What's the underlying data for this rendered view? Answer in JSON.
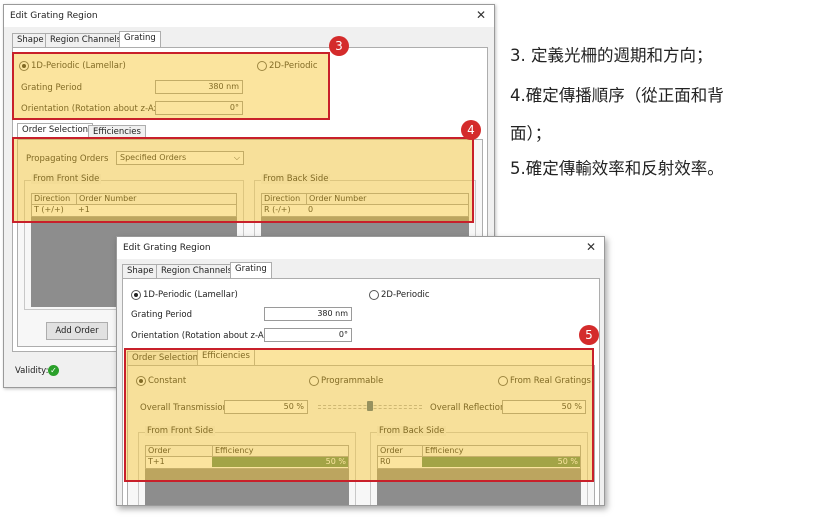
{
  "dialog_title": "Edit Grating Region",
  "tabs": [
    "Shape",
    "Region Channels",
    "Grating"
  ],
  "grating": {
    "periodic_1d": "1D-Periodic (Lamellar)",
    "periodic_2d": "2D-Periodic",
    "period_label": "Grating Period",
    "period_value": "380 nm",
    "orientation_label": "Orientation (Rotation about z-Axis)",
    "orientation_value": "0°"
  },
  "subtabs": [
    "Order Selection",
    "Efficiencies"
  ],
  "order_selection": {
    "propagating_label": "Propagating Orders",
    "propagating_value": "Specified Orders",
    "front_title": "From Front Side",
    "back_title": "From Back Side",
    "col_direction": "Direction",
    "col_order_number": "Order Number",
    "front_direction": "T (+/+)",
    "front_order": "+1",
    "back_direction": "R (-/+)",
    "back_order": "0",
    "add_order": "Add Order"
  },
  "validity_label": "Validity:",
  "efficiencies": {
    "constant": "Constant",
    "programmable": "Programmable",
    "from_real": "From Real Gratings",
    "transmission_label": "Overall Transmission",
    "transmission_value": "50 %",
    "reflection_label": "Overall Reflection",
    "reflection_value": "50 %",
    "slider_fraction": 0.5,
    "front_title": "From Front Side",
    "back_title": "From Back Side",
    "col_order": "Order",
    "col_efficiency": "Efficiency",
    "front_order": "T+1",
    "front_eff": "50 %",
    "back_order": "R0",
    "back_eff": "50 %"
  },
  "badges": [
    "3",
    "4",
    "5"
  ],
  "notes": [
    "3. 定義光柵的週期和方向；",
    "4.確定傳播順序（從正面和背",
    "面）；",
    "5.確定傳輸效率和反射效率。"
  ],
  "colors": {
    "highlight_fill": "#f6c428",
    "highlight_border": "#c8202a",
    "badge": "#d42b2b",
    "efficiency_bar": "#5f8a5f",
    "valid": "#2aa02a"
  }
}
